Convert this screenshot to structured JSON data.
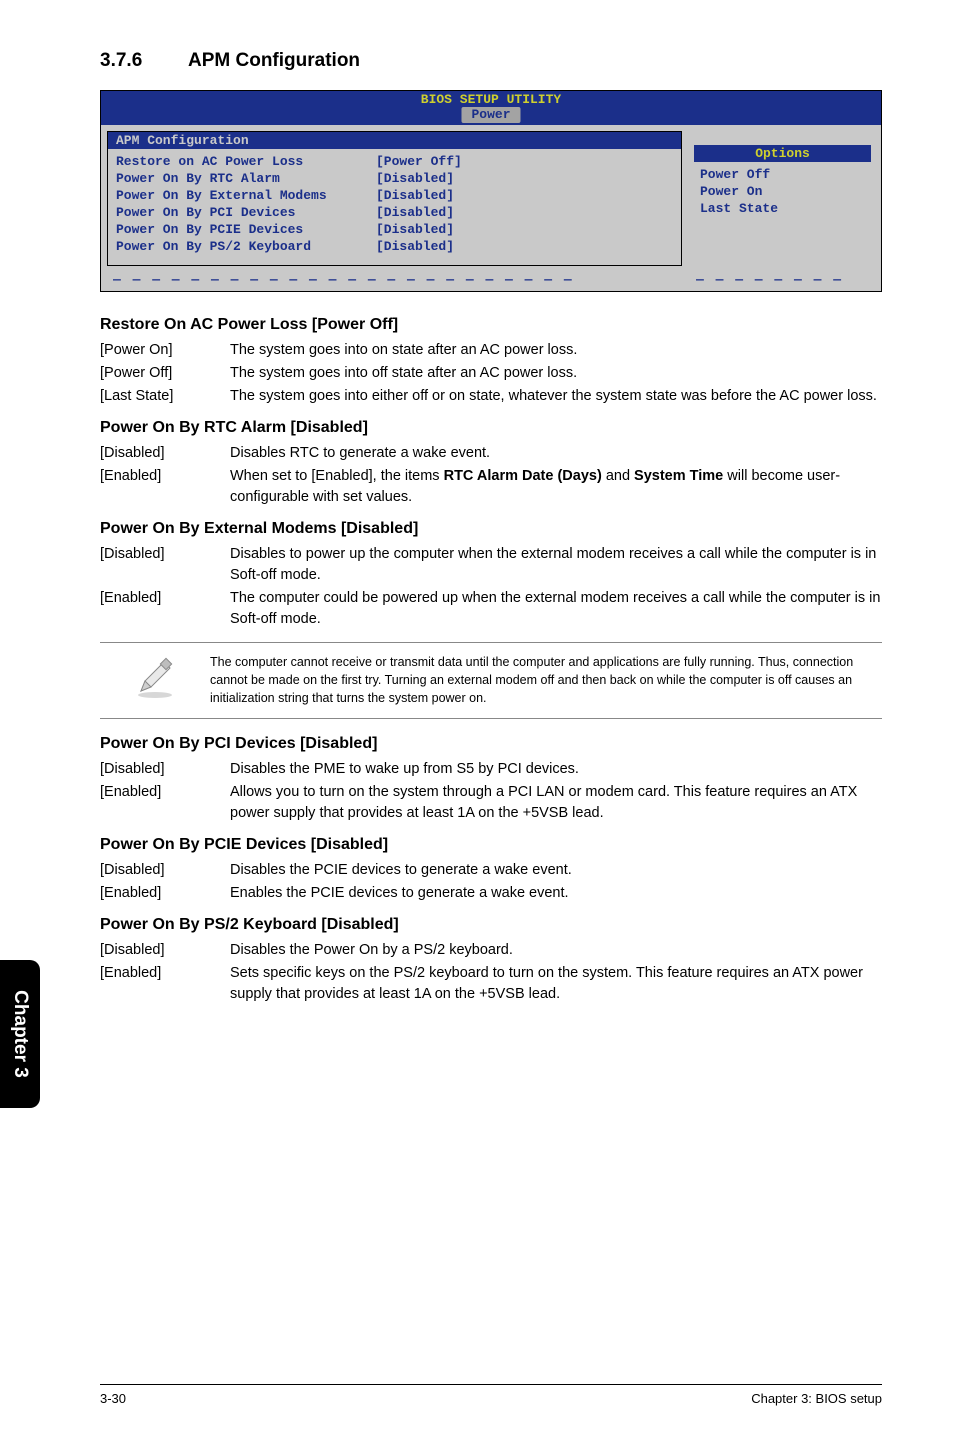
{
  "section": {
    "number": "3.7.6",
    "title": "APM Configuration"
  },
  "bios": {
    "headerTitle": "BIOS SETUP UTILITY",
    "tab": "Power",
    "panelTitle": "APM Configuration",
    "rows": [
      {
        "label": "Restore on AC Power Loss",
        "value": "[Power Off]"
      },
      {
        "label": "Power On By RTC Alarm",
        "value": "[Disabled]"
      },
      {
        "label": "Power On By External Modems",
        "value": "[Disabled]"
      },
      {
        "label": "Power On By PCI Devices",
        "value": "[Disabled]"
      },
      {
        "label": "Power On By PCIE Devices",
        "value": "[Disabled]"
      },
      {
        "label": "Power On By PS/2 Keyboard",
        "value": "[Disabled]"
      }
    ],
    "optionsHeader": "Options",
    "options": [
      "Power Off",
      "Power On",
      "Last State"
    ]
  },
  "restoreAC": {
    "heading": "Restore On AC Power Loss [Power Off]",
    "items": [
      {
        "label": "[Power On]",
        "text": "The system goes into on state after an AC power loss."
      },
      {
        "label": "[Power Off]",
        "text": "The system goes into off state after an AC power loss."
      },
      {
        "label": "[Last State]",
        "text": "The system goes into either off or on state, whatever the system state was before the AC power loss."
      }
    ]
  },
  "rtc": {
    "heading": "Power On By RTC Alarm [Disabled]",
    "items": [
      {
        "label": "[Disabled]",
        "text": "Disables RTC to generate a wake event."
      },
      {
        "label": "[Enabled]",
        "pre": "When set to [Enabled], the items ",
        "bold1": "RTC Alarm Date (Days)",
        "mid": " and ",
        "bold2": "System Time",
        "post": " will become user-configurable with set values."
      }
    ]
  },
  "extmodem": {
    "heading": "Power On By External Modems [Disabled]",
    "items": [
      {
        "label": "[Disabled]",
        "text": "Disables to power up the computer when the external modem receives a call while the computer is in Soft-off mode."
      },
      {
        "label": "[Enabled]",
        "text": "The computer could be powered up when the external modem receives a call while the computer is in Soft-off mode."
      }
    ]
  },
  "note": "The computer cannot receive or transmit data until the computer and applications are fully running. Thus, connection cannot be made on the first try. Turning an external modem off and then back on while the computer is off causes an initialization string that turns the system power on.",
  "pci": {
    "heading": "Power On By PCI Devices [Disabled]",
    "items": [
      {
        "label": "[Disabled]",
        "text": "Disables the PME to wake up from S5 by PCI devices."
      },
      {
        "label": "[Enabled]",
        "text": "Allows you to turn on the system through a PCI LAN or modem card. This feature requires an ATX power supply that provides at least 1A on the +5VSB lead."
      }
    ]
  },
  "pcie": {
    "heading": "Power On By PCIE Devices [Disabled]",
    "items": [
      {
        "label": "[Disabled]",
        "text": "Disables the PCIE devices to generate a wake event."
      },
      {
        "label": "[Enabled]",
        "text": "Enables the PCIE devices to generate a wake event."
      }
    ]
  },
  "ps2": {
    "heading": "Power On By PS/2 Keyboard [Disabled]",
    "items": [
      {
        "label": "[Disabled]",
        "text": "Disables the Power On by a PS/2 keyboard."
      },
      {
        "label": "[Enabled]",
        "text": "Sets specific keys on the PS/2 keyboard to turn on the system. This feature requires an ATX power supply that provides at least 1A on the +5VSB lead."
      }
    ]
  },
  "sideTab": "Chapter 3",
  "footer": {
    "left": "3-30",
    "right": "Chapter 3: BIOS setup"
  }
}
